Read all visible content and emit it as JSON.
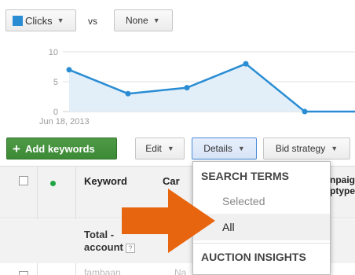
{
  "metric_selector": {
    "primary": "Clicks",
    "primary_color": "#2a8dd4",
    "vs": "vs",
    "secondary": "None"
  },
  "chart_data": {
    "type": "area",
    "x": [
      "Jun 18, 2013",
      "",
      "",
      "",
      "",
      "",
      "",
      ""
    ],
    "values": [
      7,
      3,
      4,
      8,
      0,
      0,
      0,
      0
    ],
    "y_ticks": [
      "10",
      "5",
      "0"
    ],
    "x_tick_label": "Jun 18, 2013",
    "ylim": [
      0,
      10
    ],
    "grid": true,
    "line_color": "#2a8dd4",
    "fill_color": "#e3eff8"
  },
  "toolbar": {
    "add_keywords": "Add keywords",
    "edit": "Edit",
    "details": "Details",
    "bid_strategy": "Bid strategy"
  },
  "table": {
    "col_keyword": "Keyword",
    "col_campaign": "Car",
    "col_campaign_type_1": "npaig",
    "col_campaign_type_2": "ptype",
    "total_line1": "Total -",
    "total_line2": "account",
    "help": "?",
    "row_faded_1": "fambaan",
    "row_faded_2": "Na"
  },
  "details_menu": {
    "search_terms_header": "SEARCH TERMS",
    "selected": "Selected",
    "all": "All",
    "auction_insights_header": "AUCTION INSIGHTS"
  },
  "colors": {
    "accent_green": "#3c8a35",
    "arrow_orange": "#e8650f"
  }
}
